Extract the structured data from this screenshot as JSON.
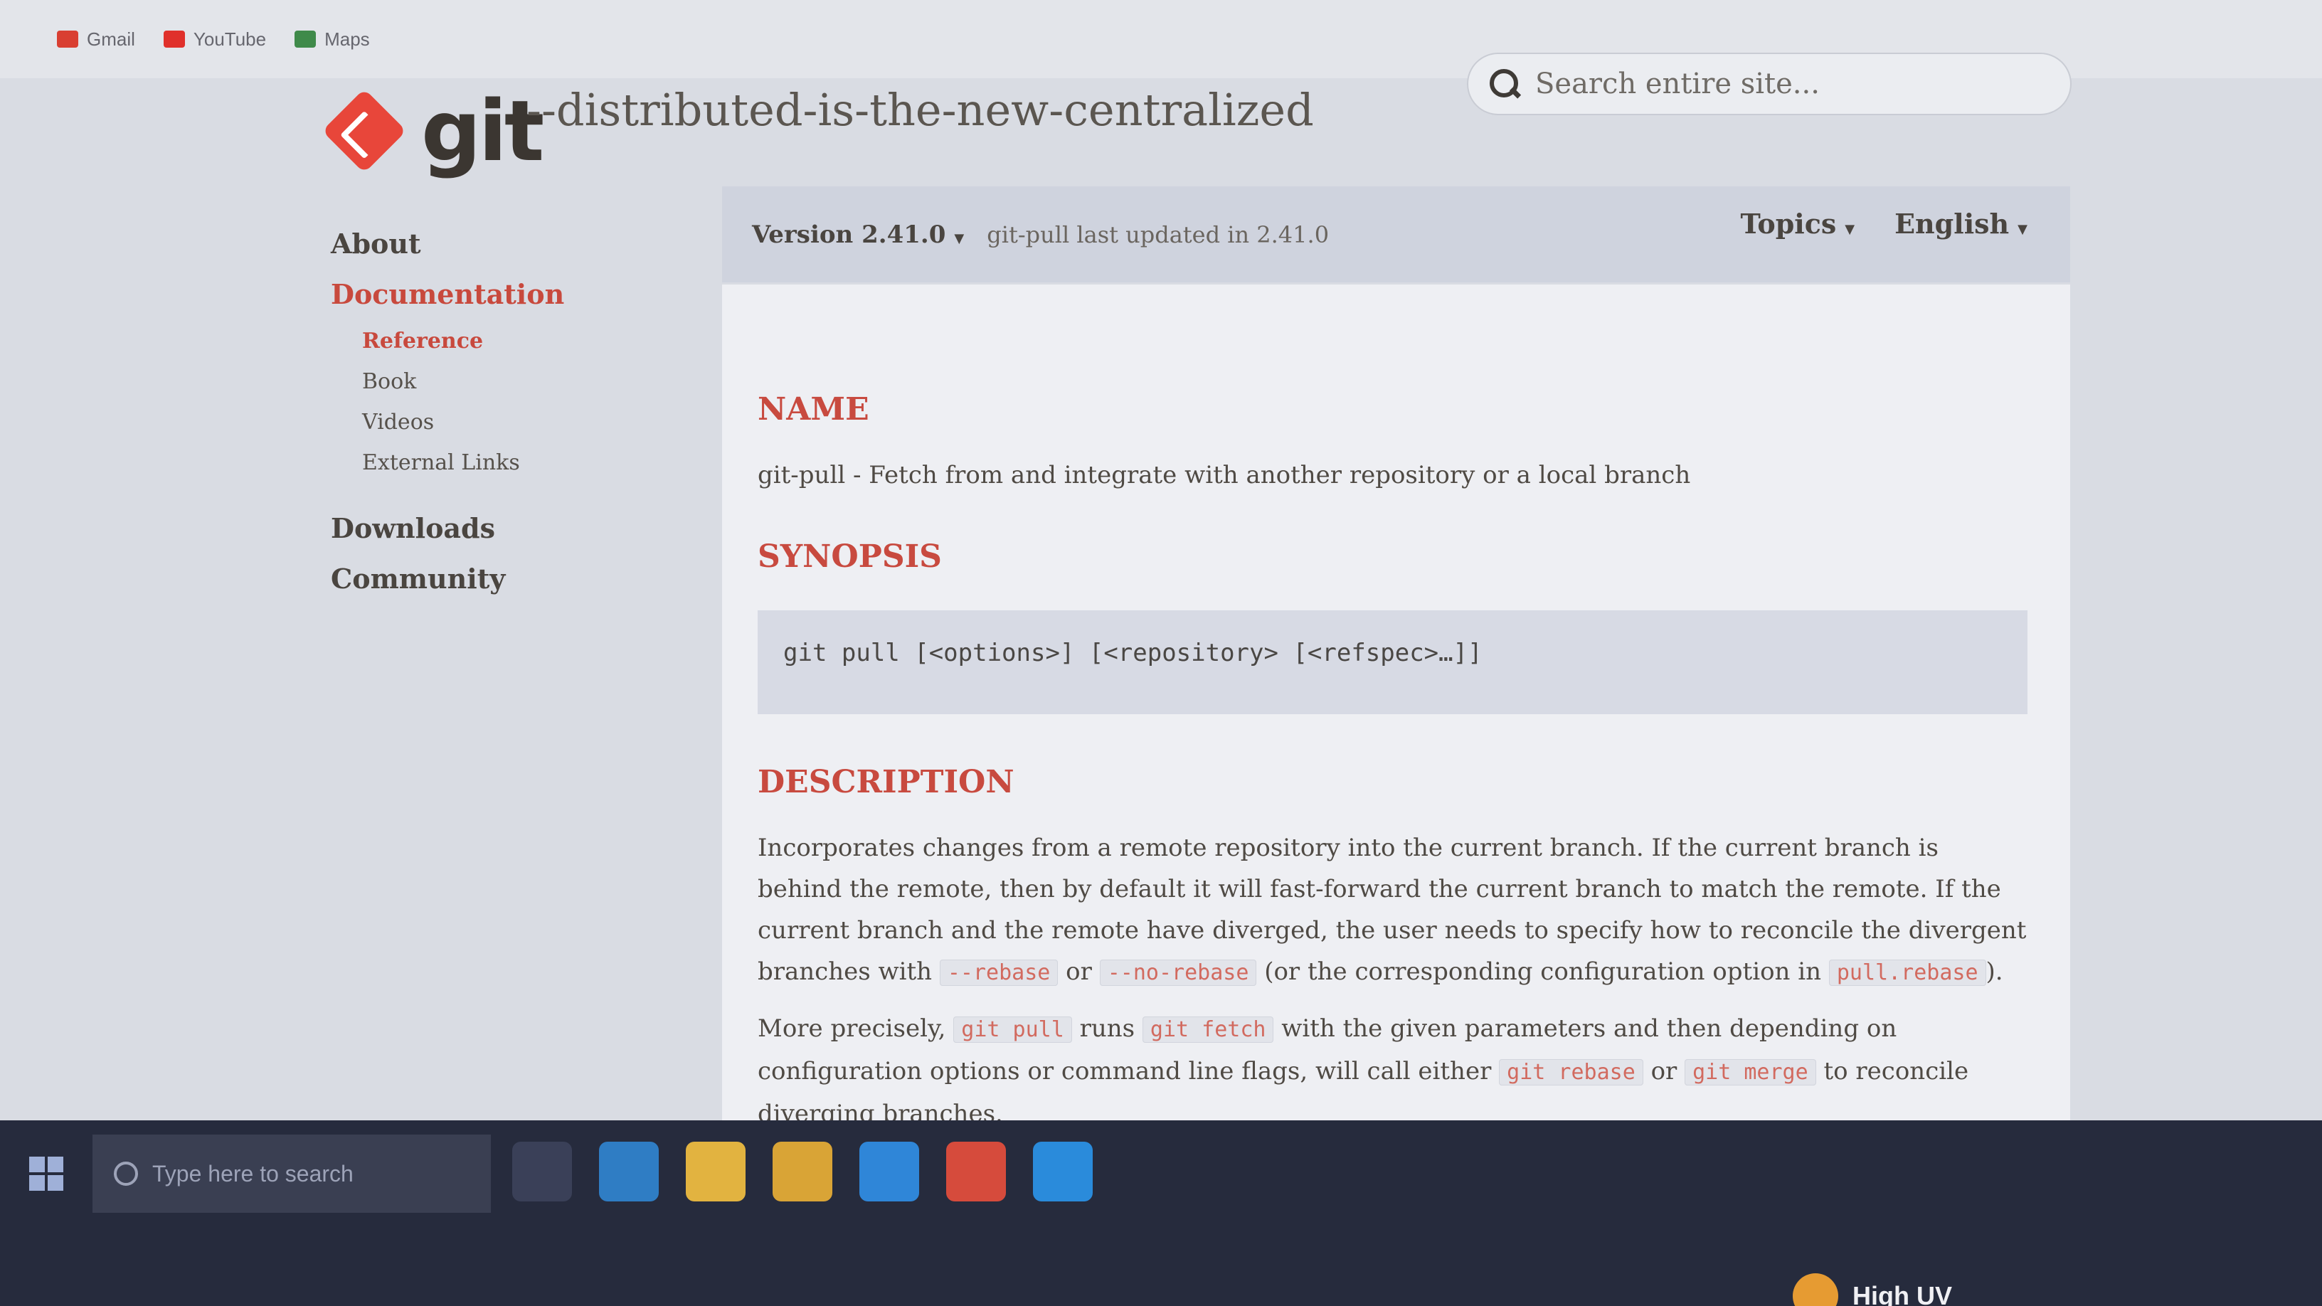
{
  "bookmarks": [
    {
      "label": "Gmail",
      "color": "#d93f32"
    },
    {
      "label": "YouTube",
      "color": "#e0302b"
    },
    {
      "label": "Maps",
      "color": "#3f8a4a"
    }
  ],
  "header": {
    "logo_text": "git",
    "tagline": "--distributed-is-the-new-centralized",
    "search_placeholder": "Search entire site..."
  },
  "sidebar": {
    "about": "About",
    "documentation": "Documentation",
    "doc_items": [
      "Reference",
      "Book",
      "Videos",
      "External Links"
    ],
    "downloads": "Downloads",
    "community": "Community"
  },
  "version_bar": {
    "version": "Version 2.41.0",
    "updated": "git-pull last updated in 2.41.0",
    "topics": "Topics",
    "language": "English"
  },
  "content": {
    "name_heading": "NAME",
    "name_text": "git-pull - Fetch from and integrate with another repository or a local branch",
    "synopsis_heading": "SYNOPSIS",
    "synopsis_code": "git pull [<options>] [<repository> [<refspec>…]]",
    "description_heading": "DESCRIPTION",
    "desc_p1_a": "Incorporates changes from a remote repository into the current branch. If the current branch is behind the remote, then by default it will fast-forward the current branch to match the remote. If the current branch and the remote have diverged, the user needs to specify how to reconcile the divergent branches with ",
    "desc_p1_code1": "--rebase",
    "desc_p1_b": " or ",
    "desc_p1_code2": "--no-rebase",
    "desc_p1_c": " (or the corresponding configuration option in ",
    "desc_p1_code3": "pull.rebase",
    "desc_p1_d": ").",
    "desc_p2_a": "More precisely, ",
    "desc_p2_code1": "git pull",
    "desc_p2_b": " runs ",
    "desc_p2_code2": "git fetch",
    "desc_p2_c": " with the given parameters and then depending on configuration options or command line flags, will call either ",
    "desc_p2_code3": "git rebase",
    "desc_p2_d": " or ",
    "desc_p2_code4": "git merge",
    "desc_p2_e": " to reconcile diverging branches."
  },
  "taskbar": {
    "search_placeholder": "Type here to search",
    "weather": "High UV"
  },
  "colors": {
    "accent": "#c8493d",
    "git_logo": "#e8463a"
  }
}
